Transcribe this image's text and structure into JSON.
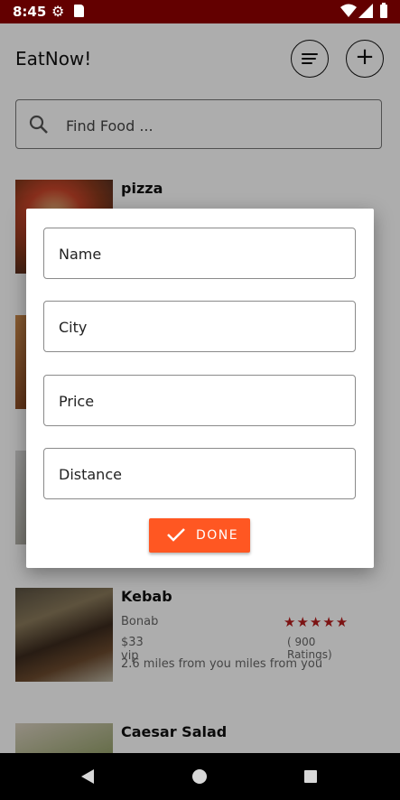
{
  "status_bar": {
    "time": "8:45"
  },
  "header": {
    "title": "EatNow!"
  },
  "search": {
    "placeholder": "Find Food ..."
  },
  "foods": [
    {
      "name": "pizza"
    },
    {
      "name": ""
    },
    {
      "name": ""
    },
    {
      "name": "Kebab",
      "city": "Bonab",
      "price": "$33 vip",
      "rating_text": "( 900 Ratings)",
      "distance": "2.6 miles from you miles from you",
      "stars": 5
    },
    {
      "name": "Caesar Salad"
    }
  ],
  "dialog": {
    "fields": [
      {
        "placeholder": "Name"
      },
      {
        "placeholder": "City"
      },
      {
        "placeholder": "Price"
      },
      {
        "placeholder": "Distance"
      }
    ],
    "done_label": "DONE"
  },
  "colors": {
    "accent": "#ff5722",
    "status_bar": "#630000",
    "stars": "#b71c1c"
  }
}
